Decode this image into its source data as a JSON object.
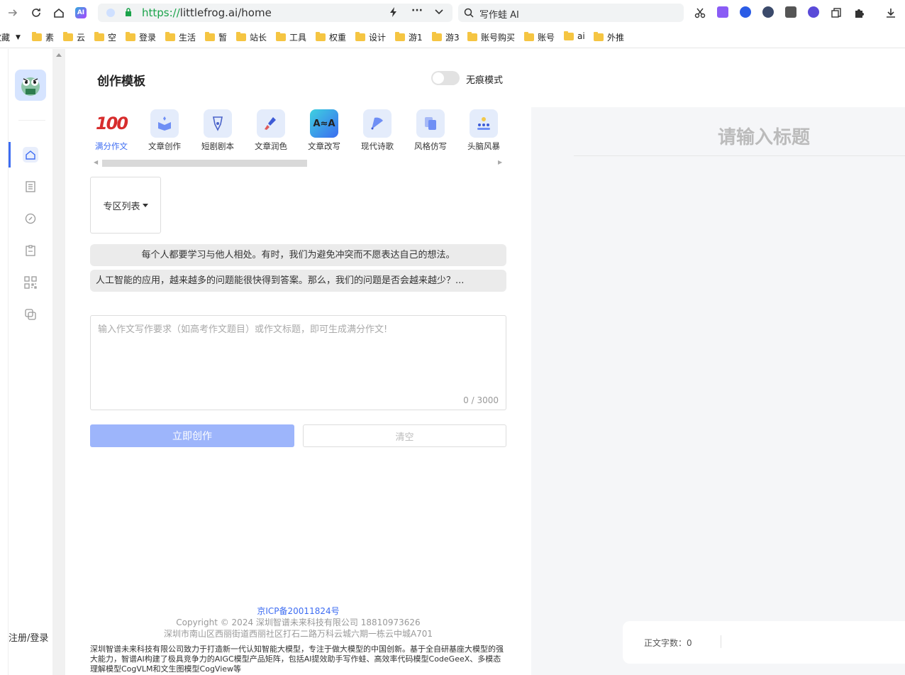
{
  "browser": {
    "url_scheme": "https://",
    "url_rest": "littlefrog.ai/home",
    "search_text": "写作蛙 AI",
    "bookmarks": [
      "收藏",
      "素",
      "云",
      "空",
      "登录",
      "生活",
      "暂",
      "站长",
      "工具",
      "权重",
      "设计",
      "游1",
      "游3",
      "账号购买",
      "账号",
      "ai",
      "外推"
    ]
  },
  "sidebar": {
    "login_label": "注册/登录"
  },
  "main": {
    "title": "创作模板",
    "toggle_label": "无痕模式",
    "tools": [
      "满分作文",
      "文章创作",
      "短剧剧本",
      "文章润色",
      "文章改写",
      "现代诗歌",
      "风格仿写",
      "头脑风暴"
    ],
    "zone_label": "专区列表",
    "samples": [
      "每个人都要学习与他人相处。有时，我们为避免冲突而不愿表达自己的想法。",
      "人工智能的应用，越来越多的问题能很快得到答案。那么，我们的问题是否会越来越少？..."
    ],
    "input_placeholder": "输入作文写作要求（如高考作文题目）或作文标题，即可生成满分作文!",
    "counter": "0 / 3000",
    "create_button": "立即创作",
    "clear_button": "清空"
  },
  "footer": {
    "icp": "京ICP备20011824号",
    "copyright": "Copyright © 2024 深圳智谱未来科技有限公司 18810973626",
    "address": "深圳市南山区西丽街道西丽社区打石二路万科云城六期一栋云中城A701",
    "description": "深圳智谱未来科技有限公司致力于打造新一代认知智能大模型，专注于做大模型的中国创新。基于全自研基座大模型的强大能力，智谱AI构建了极具竞争力的AIGC模型产品矩阵，包括AI提效助手写作蛙、高效率代码模型CodeGeeX、多模态理解模型CogVLM和文生图模型CogView等"
  },
  "right": {
    "title_placeholder": "请输入标题",
    "word_count": "正文字数：0"
  },
  "colors": {
    "accent": "#3d6cf2",
    "primary_button": "#9db5fb",
    "right_bg": "#f5f6f8"
  }
}
